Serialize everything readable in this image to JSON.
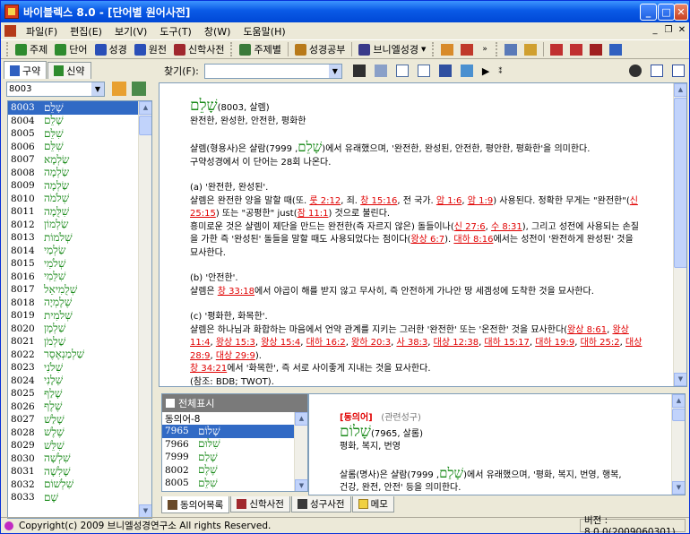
{
  "window": {
    "title": "바이블렉스 8.0 - [단어별 원어사전]",
    "min": "_",
    "max": "□",
    "close": "✕"
  },
  "menu": [
    "파일(F)",
    "편집(E)",
    "보기(V)",
    "도구(T)",
    "창(W)",
    "도움말(H)"
  ],
  "mdi_controls": [
    "_",
    "❐",
    "✕"
  ],
  "toolbar": [
    {
      "label": "주제",
      "color": "#2e8b2e"
    },
    {
      "label": "단어",
      "color": "#2e8b2e"
    },
    {
      "label": "성경",
      "color": "#2a4fb8"
    },
    {
      "label": "원전",
      "color": "#2a4fb8"
    },
    {
      "label": "신학사전",
      "color": "#a0282e"
    },
    {
      "label": "주제별",
      "color": "#3a7a3a"
    },
    {
      "label": "성경공부",
      "color": "#b87a1a"
    },
    {
      "label": "브니엘성경",
      "color": "#3a3a8a"
    }
  ],
  "left": {
    "tabs": [
      "구약",
      "신약"
    ],
    "search_value": "8003",
    "words": [
      {
        "num": "8003",
        "heb": "שָׁלֵם"
      },
      {
        "num": "8004",
        "heb": "שָׁלֵם"
      },
      {
        "num": "8005",
        "heb": "שִׁלֵּם"
      },
      {
        "num": "8006",
        "heb": "שִׁלֵּם"
      },
      {
        "num": "8007",
        "heb": "שַׂלְמָא"
      },
      {
        "num": "8008",
        "heb": "שַׂלְמָה"
      },
      {
        "num": "8009",
        "heb": "שַׂלְמָה"
      },
      {
        "num": "8010",
        "heb": "שְׁלֹמֹה"
      },
      {
        "num": "8011",
        "heb": "שִׁלֻּמָה"
      },
      {
        "num": "8012",
        "heb": "שַׂלְמוֹן"
      },
      {
        "num": "8013",
        "heb": "שְׁלֹמוֹת"
      },
      {
        "num": "8014",
        "heb": "שַׂלְמַי"
      },
      {
        "num": "8015",
        "heb": "שְׁלֹמִי"
      },
      {
        "num": "8016",
        "heb": "שִׁלֵּמִי"
      },
      {
        "num": "8017",
        "heb": "שְׁלֻמִיאֵל"
      },
      {
        "num": "8018",
        "heb": "שֶׁלֶמְיָה"
      },
      {
        "num": "8019",
        "heb": "שְׁלֹמִית"
      },
      {
        "num": "8020",
        "heb": "שַׁלְמָן"
      },
      {
        "num": "8021",
        "heb": "שַׁלְמֹן"
      },
      {
        "num": "8022",
        "heb": "שַׁלְמַנְאֶסֶר"
      },
      {
        "num": "8023",
        "heb": "שִׁלֹנִי"
      },
      {
        "num": "8024",
        "heb": "שֵׁלָנִי"
      },
      {
        "num": "8025",
        "heb": "שָׁלַף"
      },
      {
        "num": "8026",
        "heb": "שֶׁלֶף"
      },
      {
        "num": "8027",
        "heb": "שָׁלַשׁ"
      },
      {
        "num": "8028",
        "heb": "שֶׁלֶשׁ"
      },
      {
        "num": "8029",
        "heb": "שִׁלֵּשׁ"
      },
      {
        "num": "8030",
        "heb": "שִׁלְשָׁה"
      },
      {
        "num": "8031",
        "heb": "שָׁלִשָׁה"
      },
      {
        "num": "8032",
        "heb": "שִׁלְשׁוֹם"
      },
      {
        "num": "8033",
        "heb": "שָׁם"
      }
    ]
  },
  "find": {
    "label": "찾기(F):",
    "value": ""
  },
  "article": {
    "hebrew": "שָׁלֵם",
    "headref": "(8003, 살렘)",
    "gloss": "완전한, 완성한, 안전한, 평화한",
    "p1a": "샬렘(형용사)은 샬람(",
    "p1heb": "שָׁלֵם",
    "p1b": ", 7999)에서 유래했으며, '완전한, 완성된, 안전한, 평안한, 평화한'을 의미한다.",
    "p1c": "구약성경에서 이 단어는 28회 나온다.",
    "a_head": "(a) '완전한, 완성된'.",
    "a1": "샬렘은 완전한 양을 말할 때(또.",
    "a_refs": [
      "룻 2:12",
      "창 15:16",
      "암 1:6",
      "암 1:9",
      "신 25:15",
      "잠 11:1"
    ],
    "a2": "죄.",
    "a3": "전 국가.",
    "a4": ") 사용된다. 정확한 무게는 \"완전한\"(",
    "a5": ") 또는 \"공평한\" just(",
    "a6": ") 것으로 불린다.",
    "a7": "흥미로운 것은 샬렘이 제단을 만드는 완전한(즉 자르지 않은) 돌들이나(",
    "a_refs2": [
      "신 27:6",
      "수 8:31",
      "왕상 6:7",
      "대하 8:16"
    ],
    "a8": "), 그리고 성전에 사용되는",
    "a9": "손질을 가한 즉 '완성된' 돌들을 말할 때도 사용되었다는 점이다(",
    "a10": "에서는 성전이 '완전하게 완성된'",
    "a11": "것을 묘사한다.",
    "b_head": "(b) '안전한'.",
    "b_ref": "창 33:18",
    "b1": "샬렘은",
    "b2": "에서 야곱이 해를 받지 않고 무사히, 즉 안전하게 가나안 땅 세겜성에 도착한 것을 묘사한다.",
    "c_head": "(c) '평화한, 화목한'.",
    "c1": "샬렘은 하나님과 화합하는 마음에서 언약 관계를 지키는 그러한 '완전한' 또는 '온전한' 것을 묘사한다(",
    "c_refs": [
      "왕상 8:61",
      "왕상 11:4",
      "왕상 15:3",
      "왕상 15:4",
      "대하 16:2",
      "왕하 20:3",
      "사 38:3",
      "대상 12:38",
      "대하 15:17",
      "대하 19:9",
      "대하 25:2",
      "대상 28:9",
      "대상 29:9"
    ],
    "c_end": ").",
    "c_ref2": "창 34:21",
    "c2": "에서 '화목한', 즉 서로 사이좋게 지내는 것을 묘사한다.",
    "refnote": "(참조: BDB; TWOT)."
  },
  "related": {
    "header": "전체표시",
    "group": "동의어-8",
    "items": [
      {
        "num": "7965",
        "heb": "שָׁלוֹם"
      },
      {
        "num": "7966",
        "heb": "שִׁלּוּם"
      },
      {
        "num": "7999",
        "heb": "שָׁלַם"
      },
      {
        "num": "8002",
        "heb": "שֶׁלֶם"
      },
      {
        "num": "8005",
        "heb": "שִׁלֵּם"
      }
    ]
  },
  "rel_article": {
    "tag": "[동의어]",
    "tag2": "(관련성구)",
    "hebrew": "שָׁלוֹם",
    "headref": "(7965, 살롬)",
    "gloss": "평화, 복지, 번영",
    "p1a": "살롬(명사)은 샬람(",
    "p1heb": "שָׁלַם",
    "p1b": ", 7999)에서 유래했으며, '평화, 복지, 번영, 행복,",
    "p1c": "건강, 완전, 안전' 등을 의미한다."
  },
  "bottom_tabs": [
    "동의어목록",
    "신학사전",
    "성구사전",
    "메모"
  ],
  "status": {
    "copyright": "Copyright(c) 2009 브니엘성경연구소 All rights Reserved.",
    "version": "버전 : 8.0.0(2009060301)"
  }
}
